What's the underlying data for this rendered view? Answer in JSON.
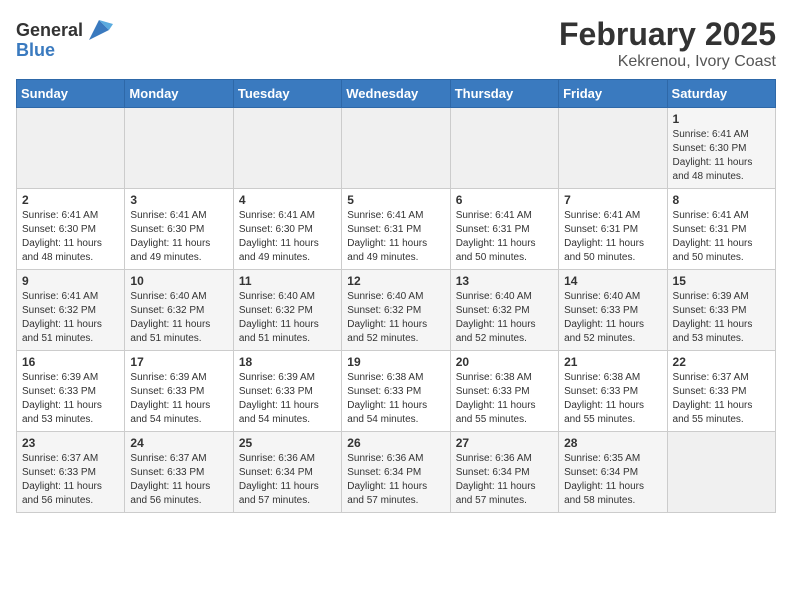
{
  "header": {
    "logo_general": "General",
    "logo_blue": "Blue",
    "title": "February 2025",
    "subtitle": "Kekrenou, Ivory Coast"
  },
  "weekdays": [
    "Sunday",
    "Monday",
    "Tuesday",
    "Wednesday",
    "Thursday",
    "Friday",
    "Saturday"
  ],
  "weeks": [
    [
      {
        "day": "",
        "info": ""
      },
      {
        "day": "",
        "info": ""
      },
      {
        "day": "",
        "info": ""
      },
      {
        "day": "",
        "info": ""
      },
      {
        "day": "",
        "info": ""
      },
      {
        "day": "",
        "info": ""
      },
      {
        "day": "1",
        "info": "Sunrise: 6:41 AM\nSunset: 6:30 PM\nDaylight: 11 hours\nand 48 minutes."
      }
    ],
    [
      {
        "day": "2",
        "info": "Sunrise: 6:41 AM\nSunset: 6:30 PM\nDaylight: 11 hours\nand 48 minutes."
      },
      {
        "day": "3",
        "info": "Sunrise: 6:41 AM\nSunset: 6:30 PM\nDaylight: 11 hours\nand 49 minutes."
      },
      {
        "day": "4",
        "info": "Sunrise: 6:41 AM\nSunset: 6:30 PM\nDaylight: 11 hours\nand 49 minutes."
      },
      {
        "day": "5",
        "info": "Sunrise: 6:41 AM\nSunset: 6:31 PM\nDaylight: 11 hours\nand 49 minutes."
      },
      {
        "day": "6",
        "info": "Sunrise: 6:41 AM\nSunset: 6:31 PM\nDaylight: 11 hours\nand 50 minutes."
      },
      {
        "day": "7",
        "info": "Sunrise: 6:41 AM\nSunset: 6:31 PM\nDaylight: 11 hours\nand 50 minutes."
      },
      {
        "day": "8",
        "info": "Sunrise: 6:41 AM\nSunset: 6:31 PM\nDaylight: 11 hours\nand 50 minutes."
      }
    ],
    [
      {
        "day": "9",
        "info": "Sunrise: 6:41 AM\nSunset: 6:32 PM\nDaylight: 11 hours\nand 51 minutes."
      },
      {
        "day": "10",
        "info": "Sunrise: 6:40 AM\nSunset: 6:32 PM\nDaylight: 11 hours\nand 51 minutes."
      },
      {
        "day": "11",
        "info": "Sunrise: 6:40 AM\nSunset: 6:32 PM\nDaylight: 11 hours\nand 51 minutes."
      },
      {
        "day": "12",
        "info": "Sunrise: 6:40 AM\nSunset: 6:32 PM\nDaylight: 11 hours\nand 52 minutes."
      },
      {
        "day": "13",
        "info": "Sunrise: 6:40 AM\nSunset: 6:32 PM\nDaylight: 11 hours\nand 52 minutes."
      },
      {
        "day": "14",
        "info": "Sunrise: 6:40 AM\nSunset: 6:33 PM\nDaylight: 11 hours\nand 52 minutes."
      },
      {
        "day": "15",
        "info": "Sunrise: 6:39 AM\nSunset: 6:33 PM\nDaylight: 11 hours\nand 53 minutes."
      }
    ],
    [
      {
        "day": "16",
        "info": "Sunrise: 6:39 AM\nSunset: 6:33 PM\nDaylight: 11 hours\nand 53 minutes."
      },
      {
        "day": "17",
        "info": "Sunrise: 6:39 AM\nSunset: 6:33 PM\nDaylight: 11 hours\nand 54 minutes."
      },
      {
        "day": "18",
        "info": "Sunrise: 6:39 AM\nSunset: 6:33 PM\nDaylight: 11 hours\nand 54 minutes."
      },
      {
        "day": "19",
        "info": "Sunrise: 6:38 AM\nSunset: 6:33 PM\nDaylight: 11 hours\nand 54 minutes."
      },
      {
        "day": "20",
        "info": "Sunrise: 6:38 AM\nSunset: 6:33 PM\nDaylight: 11 hours\nand 55 minutes."
      },
      {
        "day": "21",
        "info": "Sunrise: 6:38 AM\nSunset: 6:33 PM\nDaylight: 11 hours\nand 55 minutes."
      },
      {
        "day": "22",
        "info": "Sunrise: 6:37 AM\nSunset: 6:33 PM\nDaylight: 11 hours\nand 55 minutes."
      }
    ],
    [
      {
        "day": "23",
        "info": "Sunrise: 6:37 AM\nSunset: 6:33 PM\nDaylight: 11 hours\nand 56 minutes."
      },
      {
        "day": "24",
        "info": "Sunrise: 6:37 AM\nSunset: 6:33 PM\nDaylight: 11 hours\nand 56 minutes."
      },
      {
        "day": "25",
        "info": "Sunrise: 6:36 AM\nSunset: 6:34 PM\nDaylight: 11 hours\nand 57 minutes."
      },
      {
        "day": "26",
        "info": "Sunrise: 6:36 AM\nSunset: 6:34 PM\nDaylight: 11 hours\nand 57 minutes."
      },
      {
        "day": "27",
        "info": "Sunrise: 6:36 AM\nSunset: 6:34 PM\nDaylight: 11 hours\nand 57 minutes."
      },
      {
        "day": "28",
        "info": "Sunrise: 6:35 AM\nSunset: 6:34 PM\nDaylight: 11 hours\nand 58 minutes."
      },
      {
        "day": "",
        "info": ""
      }
    ]
  ]
}
